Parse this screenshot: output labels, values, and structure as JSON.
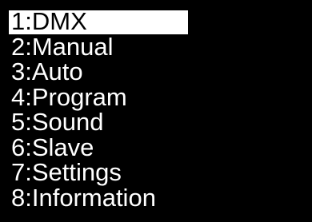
{
  "menu": {
    "selected_index": 0,
    "items": [
      {
        "label": "1:DMX"
      },
      {
        "label": "2:Manual"
      },
      {
        "label": "3:Auto"
      },
      {
        "label": "4:Program"
      },
      {
        "label": "5:Sound"
      },
      {
        "label": "6:Slave"
      },
      {
        "label": "7:Settings"
      },
      {
        "label": "8:Information"
      }
    ]
  },
  "colors": {
    "background": "#000000",
    "text": "#ffffff",
    "highlight": "#ffffff",
    "highlight_text": "#000000"
  }
}
